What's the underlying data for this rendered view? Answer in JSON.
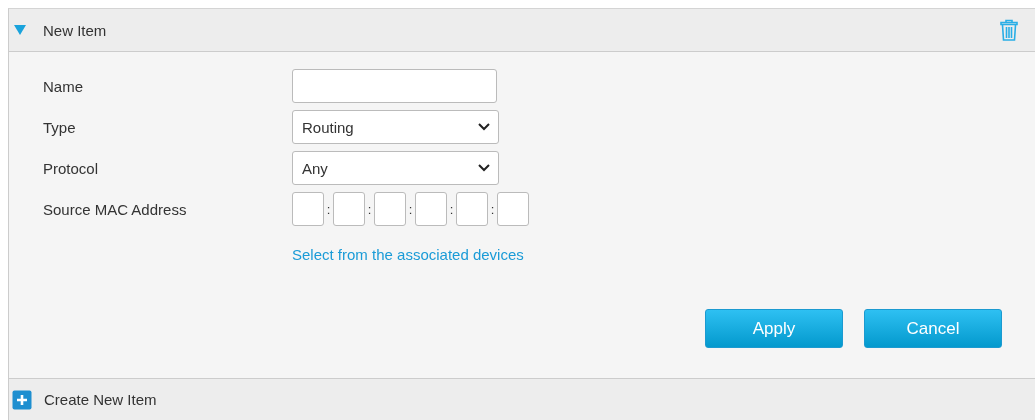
{
  "section": {
    "title": "New Item",
    "expanded": true
  },
  "fields": [
    {
      "kind": "text",
      "label": "Name"
    },
    {
      "kind": "select",
      "label": "Type",
      "value": "Routing"
    },
    {
      "kind": "select",
      "label": "Protocol",
      "value": "Any"
    },
    {
      "kind": "mac",
      "label": "Source MAC Address",
      "separators": [
        ":",
        ":",
        ":",
        ":",
        ":"
      ],
      "link": "Select from the associated devices"
    }
  ],
  "buttons": [
    "Apply",
    "Cancel"
  ],
  "footer": {
    "label": "Create New Item"
  }
}
